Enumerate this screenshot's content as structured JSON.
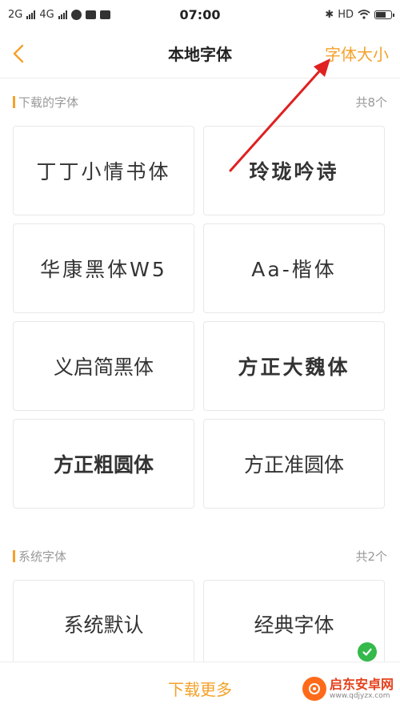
{
  "status_bar": {
    "network_left": "2G",
    "network_right": "4G",
    "time": "07:00",
    "hd": "HD",
    "battery_level": 0.75
  },
  "nav": {
    "title": "本地字体",
    "action": "字体大小"
  },
  "downloaded": {
    "title": "下载的字体",
    "count": "共8个",
    "fonts": [
      "丁丁小情书体",
      "玲珑吟诗",
      "华康黑体W5",
      "Aa-楷体",
      "义启简黑体",
      "方正大魏体",
      "方正粗圆体",
      "方正准圆体"
    ]
  },
  "system": {
    "title": "系统字体",
    "count": "共2个",
    "fonts": [
      "系统默认",
      "经典字体"
    ]
  },
  "bottom": {
    "download_more": "下载更多"
  },
  "watermark": {
    "cn": "启东安卓网",
    "en": "www.qdjyzx.com"
  },
  "colors": {
    "accent": "#f5a12a",
    "selected": "#34b94a",
    "annotation": "#e02020"
  }
}
